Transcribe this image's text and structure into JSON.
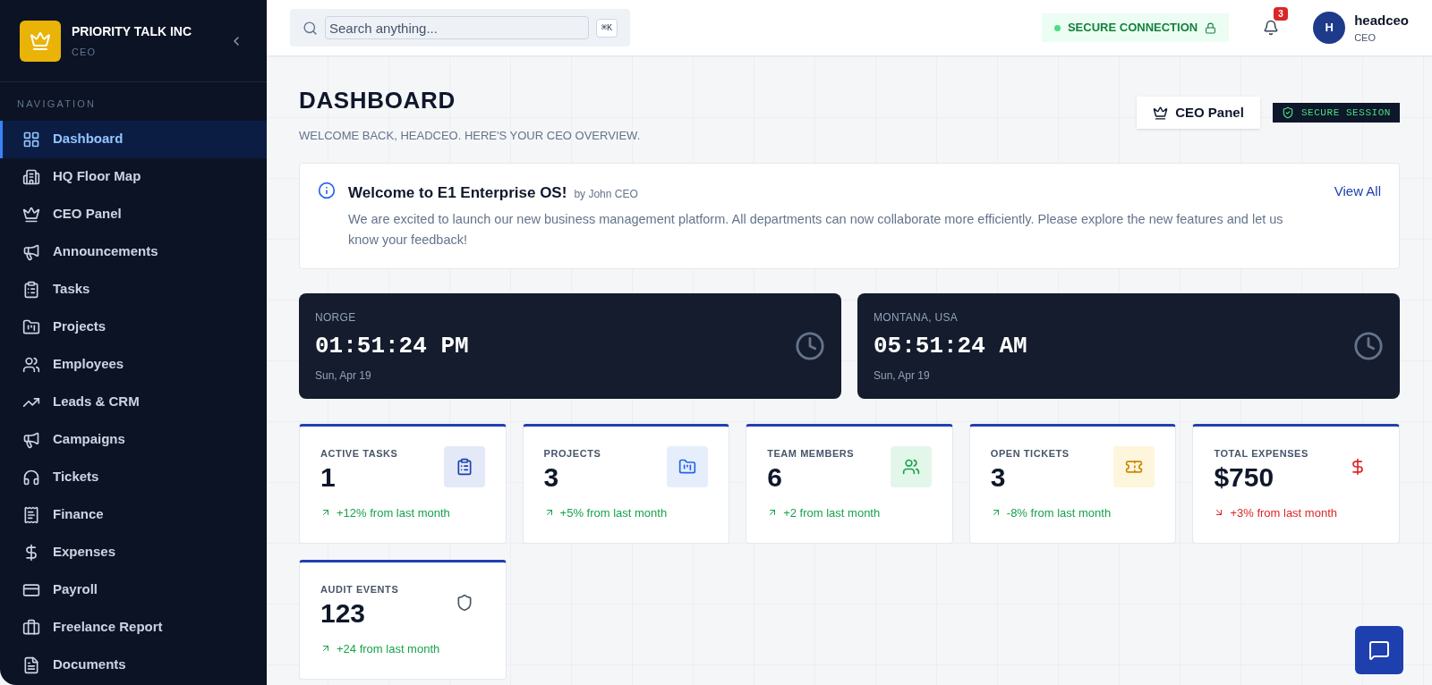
{
  "sidebar": {
    "brand": "PRIORITY TALK INC",
    "role": "CEO",
    "section": "NAVIGATION",
    "items": [
      {
        "label": "Dashboard",
        "selected": true
      },
      {
        "label": "HQ Floor Map",
        "selected": false
      },
      {
        "label": "CEO Panel",
        "selected": false
      },
      {
        "label": "Announcements",
        "selected": false
      },
      {
        "label": "Tasks",
        "selected": false
      },
      {
        "label": "Projects",
        "selected": false
      },
      {
        "label": "Employees",
        "selected": false
      },
      {
        "label": "Leads & CRM",
        "selected": false
      },
      {
        "label": "Campaigns",
        "selected": false
      },
      {
        "label": "Tickets",
        "selected": false
      },
      {
        "label": "Finance",
        "selected": false
      },
      {
        "label": "Expenses",
        "selected": false
      },
      {
        "label": "Payroll",
        "selected": false
      },
      {
        "label": "Freelance Report",
        "selected": false
      },
      {
        "label": "Documents",
        "selected": false
      }
    ]
  },
  "topbar": {
    "search": {
      "placeholder": "Search anything..."
    },
    "shortcut": "⌘K",
    "connection": "SECURE CONNECTION",
    "notifications": "3",
    "user": {
      "initial": "H",
      "name": "headceo",
      "role": "CEO"
    }
  },
  "header": {
    "title": "DASHBOARD",
    "subtitle": "WELCOME BACK, HEADCEO. HERE'S YOUR CEO OVERVIEW.",
    "panel_button": "CEO Panel",
    "session_badge": "SECURE SESSION"
  },
  "announcement": {
    "title": "Welcome to E1 Enterprise OS!",
    "author": "by John CEO",
    "body": "We are excited to launch our new business management platform. All departments can now collaborate more efficiently. Please explore the new features and let us know your feedback!",
    "link": "View All"
  },
  "clocks": [
    {
      "place": "NORGE",
      "time": "01:51:24 PM",
      "date": "Sun, Apr 19"
    },
    {
      "place": "MONTANA, USA",
      "time": "05:51:24 AM",
      "date": "Sun, Apr 19"
    }
  ],
  "stats": [
    {
      "label": "ACTIVE TASKS",
      "value": "1",
      "negative": false,
      "change": "+12% from last month"
    },
    {
      "label": "PROJECTS",
      "value": "3",
      "negative": false,
      "change": "+5% from last month"
    },
    {
      "label": "TEAM MEMBERS",
      "value": "6",
      "negative": false,
      "change": "+2 from last month"
    },
    {
      "label": "OPEN TICKETS",
      "value": "3",
      "negative": false,
      "change": "-8% from last month"
    },
    {
      "label": "TOTAL EXPENSES",
      "value": "$750",
      "negative": true,
      "change": "+3% from last month"
    },
    {
      "label": "AUDIT EVENTS",
      "value": "123",
      "negative": false,
      "change": "+24 from last month"
    }
  ]
}
